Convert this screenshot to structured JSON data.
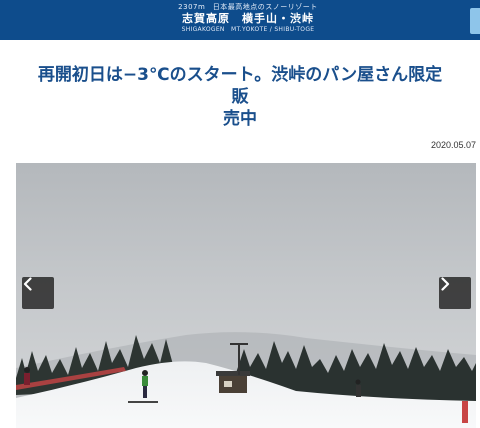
{
  "header": {
    "tagline": "2307m　日本最高地点のスノーリゾート",
    "brand": "志賀高原　横手山・渋峠",
    "brand_en": "SHIGAKOGEN　MT.YOKOTE / SHIBU-TOGE"
  },
  "article": {
    "title_line1": "再開初日は−3℃のスタート。渋峠のパン屋さん限定販",
    "title_line2": "売中",
    "date": "2020.05.07"
  },
  "slider": {
    "prev_icon": "chevron-left-icon",
    "next_icon": "chevron-right-icon"
  },
  "colors": {
    "header_bg": "#0e4c8c",
    "title": "#1a4f8c",
    "arrow_bg": "#282828"
  }
}
